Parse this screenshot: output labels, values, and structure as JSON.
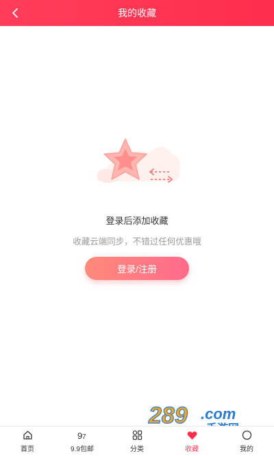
{
  "header": {
    "title": "我的收藏"
  },
  "empty_state": {
    "title": "登录后添加收藏",
    "subtitle": "收藏云端同步，不错过任何优惠哦",
    "button_label": "登录/注册"
  },
  "watermark": {
    "text": "289.com",
    "subtext": "手游网"
  },
  "tabbar": {
    "items": [
      {
        "label": "首页",
        "icon": "home-icon",
        "active": false
      },
      {
        "label": "9.9包邮",
        "icon": "nine-nine-icon",
        "active": false
      },
      {
        "label": "分类",
        "icon": "category-icon",
        "active": false
      },
      {
        "label": "收藏",
        "icon": "heart-icon",
        "active": true
      },
      {
        "label": "我的",
        "icon": "profile-icon",
        "active": false
      }
    ]
  },
  "colors": {
    "header_bg": "#fe2e4d",
    "accent": "#ff3d5a",
    "button_start": "#ff8a7a",
    "button_end": "#ff6b8b"
  }
}
